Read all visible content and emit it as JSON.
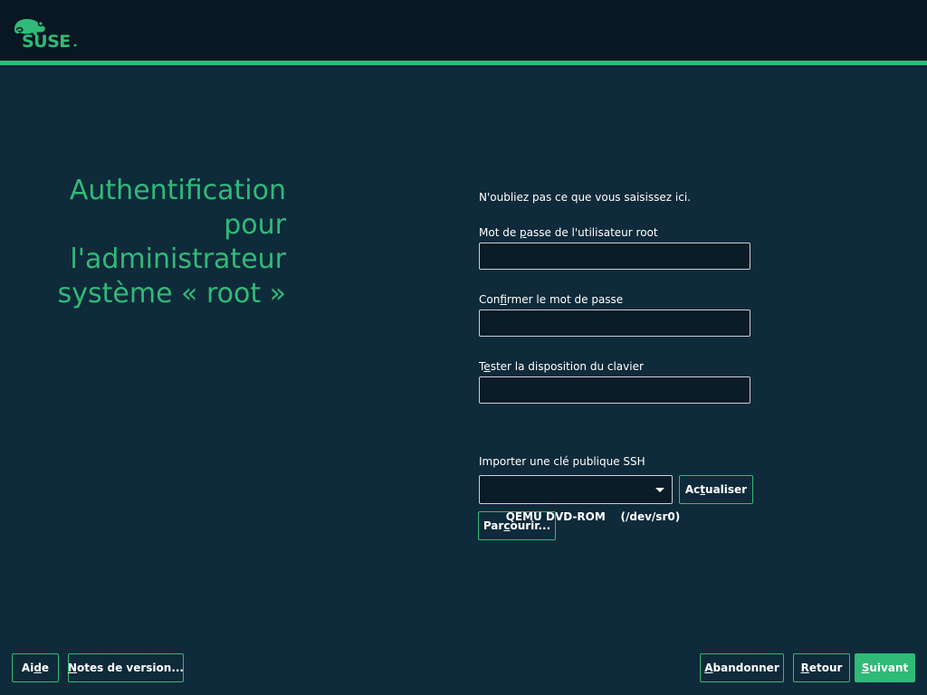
{
  "header": {
    "logo_text": "SUSE"
  },
  "title": {
    "line1": "Authentification",
    "line2": "pour",
    "line3": "l'administrateur",
    "line4": "système « root »"
  },
  "form": {
    "note": "N'oubliez pas ce que vous saisissez ici.",
    "root_password": {
      "pre": "Mot de ",
      "acc": "p",
      "post": "asse de l'utilisateur root",
      "value": ""
    },
    "confirm_password": {
      "pre": "Con",
      "acc": "f",
      "post": "irmer le mot de passe",
      "value": ""
    },
    "keyboard_test": {
      "pre": "T",
      "acc": "e",
      "post": "ster la disposition du clavier",
      "value": ""
    },
    "ssh": {
      "label": "Importer une clé publique SSH",
      "device": "QEMU DVD-ROM",
      "device_path": "(/dev/sr0)",
      "refresh": {
        "pre": "Ac",
        "acc": "t",
        "post": "ualiser"
      },
      "browse": {
        "pre": "Par",
        "acc": "c",
        "post": "ourir..."
      }
    }
  },
  "footer": {
    "help": {
      "pre": "Ai",
      "acc": "d",
      "post": "e"
    },
    "release_notes": {
      "pre": "",
      "acc": "N",
      "post": "otes de version..."
    },
    "abort": {
      "pre": "",
      "acc": "A",
      "post": "bandonner"
    },
    "back": {
      "pre": "",
      "acc": "R",
      "post": "etour"
    },
    "next": {
      "pre": "",
      "acc": "S",
      "post": "uivant"
    }
  },
  "colors": {
    "accent": "#30ba78",
    "background": "#0f2a3a",
    "header": "#081722",
    "input": "#0a1c28"
  }
}
